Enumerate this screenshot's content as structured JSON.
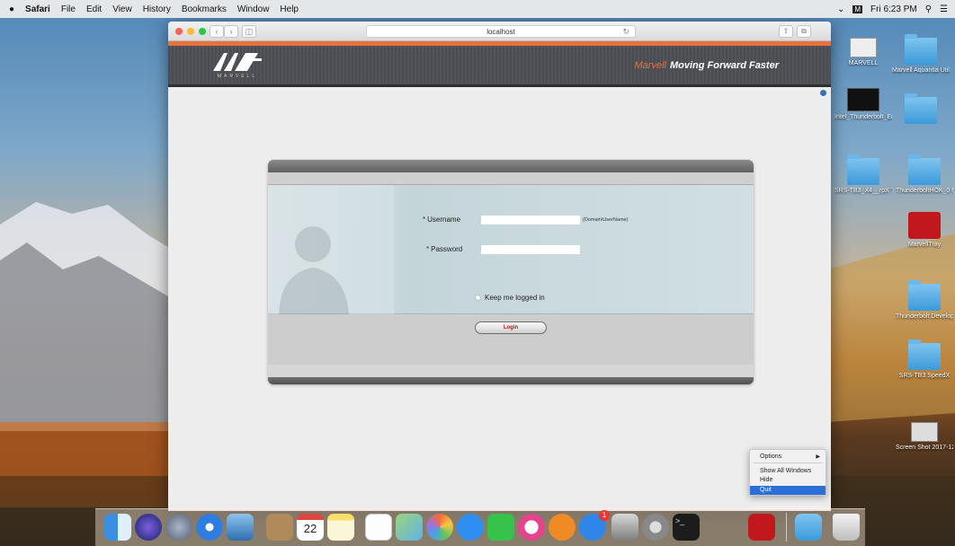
{
  "menubar": {
    "apple": "",
    "items": [
      "Safari",
      "File",
      "Edit",
      "View",
      "History",
      "Bookmarks",
      "Window",
      "Help"
    ],
    "clock": "Fri 6:23 PM"
  },
  "desktop": {
    "icons": [
      {
        "label": "MARVELL",
        "kind": "image"
      },
      {
        "label": "Marvell Aquantia Utils",
        "kind": "folder"
      },
      {
        "label": "Intel_Thunderbolt_Embed...ed4.mp4",
        "kind": "video"
      },
      {
        "label": "",
        "kind": "folder"
      },
      {
        "label": "SRS-TB3_X4__rpX Test",
        "kind": "folder"
      },
      {
        "label": "ThunderboltHOK_0 6_22_2017",
        "kind": "folder"
      },
      {
        "label": "MarvellTray",
        "kind": "app"
      },
      {
        "label": "Thunderbolt Developer Tools",
        "kind": "folder"
      },
      {
        "label": "SRS-TB3 SpeedX",
        "kind": "folder"
      },
      {
        "label": "Screen Shot 2017-12-...7.58 PM",
        "kind": "image"
      }
    ]
  },
  "browser": {
    "url": "localhost",
    "banner": {
      "logo_word": "MARVELL",
      "tagline_brand": "Marvell",
      "tagline": "Moving Forward Faster"
    },
    "login": {
      "username_label": "Username",
      "username_value": "",
      "username_hint": "(Domain\\UserName)",
      "password_label": "Password",
      "password_value": "",
      "required_mark": "*",
      "keep_logged_label": "Keep me logged in",
      "login_button": "Login"
    }
  },
  "dock": {
    "calendar_day": "22",
    "apps": [
      "Finder",
      "Siri",
      "Launchpad",
      "Safari",
      "Preview",
      "Contacts",
      "Calendar",
      "Notes",
      "Reminders",
      "Maps",
      "Photos",
      "Messages",
      "FaceTime",
      "iTunes",
      "iBooks",
      "App Store",
      "Disk Utility",
      "System Preferences",
      "Terminal",
      "MarvellTray",
      "Downloads",
      "Trash"
    ],
    "app_store_badge": "1"
  },
  "context_menu": {
    "items": [
      "Options",
      "Show All Windows",
      "Hide",
      "Quit"
    ],
    "selected": "Quit"
  },
  "colors": {
    "accent": "#e8703a",
    "banner": "#4a4c52",
    "selection": "#2c6fd6",
    "login_text": "#b01a1a"
  }
}
